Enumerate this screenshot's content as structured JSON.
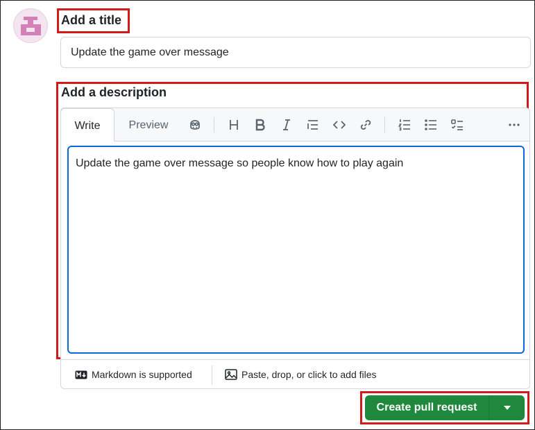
{
  "title_section": {
    "label": "Add a title",
    "value": "Update the game over message"
  },
  "description_section": {
    "label": "Add a description",
    "tabs": [
      "Write",
      "Preview"
    ],
    "active_tab": "Write",
    "toolbar_icons": [
      "copilot-icon",
      "heading-icon",
      "bold-icon",
      "italic-icon",
      "quote-icon",
      "code-icon",
      "link-icon",
      "ordered-list-icon",
      "unordered-list-icon",
      "task-list-icon",
      "more-icon"
    ],
    "body": "Update the game over message so people know how to play again"
  },
  "footer": {
    "markdown_label": "Markdown is supported",
    "files_label": "Paste, drop, or click to add files"
  },
  "actions": {
    "create_label": "Create pull request"
  },
  "colors": {
    "primary_green": "#1f883d",
    "focus_blue": "#0969da",
    "highlight_red": "#d11a1a",
    "avatar_pink": "#d57fb9"
  }
}
